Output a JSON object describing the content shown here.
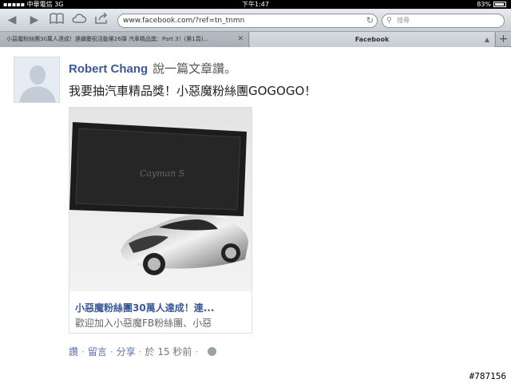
{
  "status_bar": {
    "carrier": "中華電信",
    "network": "3G",
    "time": "下午1:47",
    "battery": "83%"
  },
  "toolbar": {
    "url": "www.facebook.com/?ref=tn_tnmn",
    "search_placeholder": "搜尋"
  },
  "tabs": [
    {
      "label": "小惡魔粉絲團30萬人達成！連續慶祝活動第26彈 汽車精品獎：Part 3！(第1頁)..."
    },
    {
      "label": "Facebook"
    }
  ],
  "post": {
    "author": "Robert Chang",
    "action": "說一篇文章讚。",
    "message": "我要抽汽車精品獎！小惡魔粉絲團GOGOGO！",
    "link_title": "小惡魔粉絲團30萬人達成！連...",
    "link_desc": "歡迎加入小惡魔FB粉絲團、小惡",
    "actions": {
      "like": "讚",
      "comment": "留言",
      "share": "分享",
      "time": "於 15 秒前"
    }
  },
  "watermark": "#787156"
}
